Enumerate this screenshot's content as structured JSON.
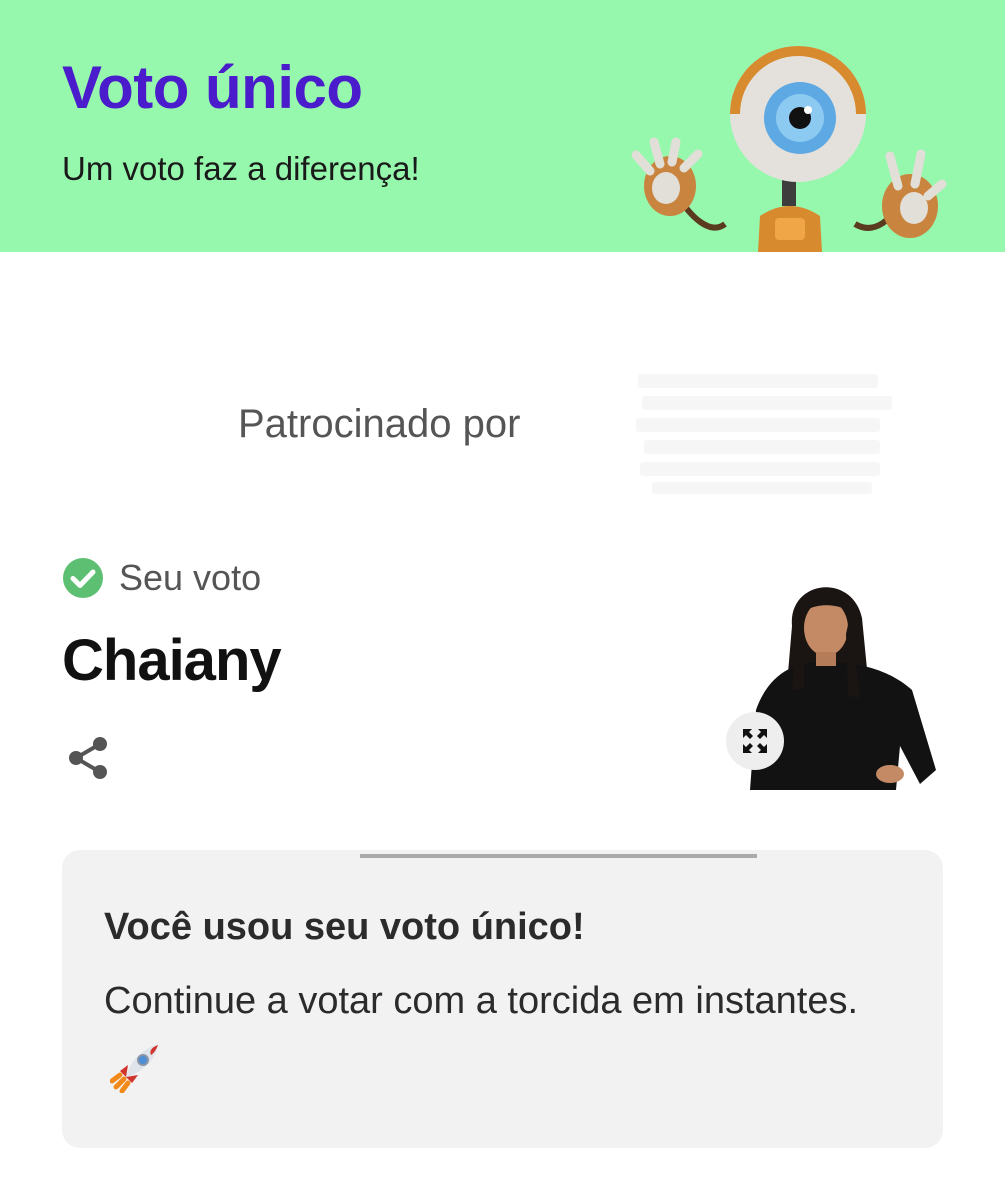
{
  "header": {
    "title": "Voto único",
    "subtitle": "Um voto faz a diferença!",
    "mascot_icon": "big-brother-eye-mascot",
    "background_color": "#95f8ad",
    "title_color": "#4a1ccb"
  },
  "sponsor": {
    "label": "Patrocinado por"
  },
  "vote": {
    "status_label": "Seu voto",
    "candidate_name": "Chaiany",
    "check_color": "#5cbf72",
    "share_icon": "share-icon",
    "expand_icon": "expand-icon"
  },
  "info_card": {
    "title": "Você usou seu voto único!",
    "message": "Continue a votar com a torcida em instantes.",
    "emoji_icon": "rocket-icon",
    "background_color": "#f2f2f2"
  }
}
